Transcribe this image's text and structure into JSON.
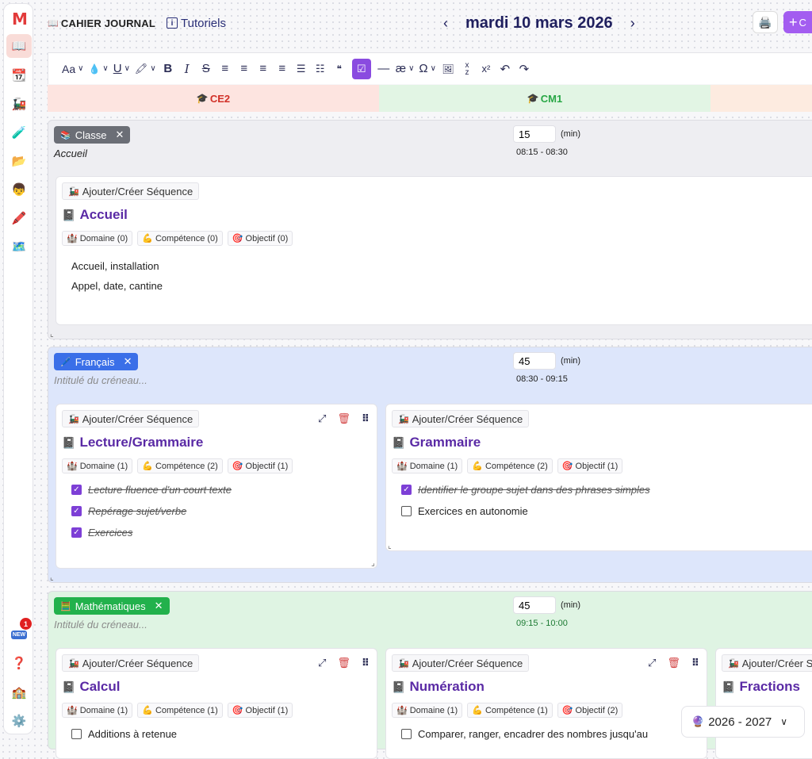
{
  "sidebar": {
    "logo": "M",
    "items": [
      {
        "name": "sidebar-item-journal",
        "icon": "📖",
        "active": true
      },
      {
        "name": "sidebar-item-calendar",
        "icon": "📆"
      },
      {
        "name": "sidebar-item-sequences",
        "icon": "🚂"
      },
      {
        "name": "sidebar-item-programs",
        "icon": "🧪"
      },
      {
        "name": "sidebar-item-files",
        "icon": "📂"
      },
      {
        "name": "sidebar-item-students",
        "icon": "👦"
      },
      {
        "name": "sidebar-item-evaluations",
        "icon": "🖍️"
      },
      {
        "name": "sidebar-item-gallery",
        "icon": "🗺️"
      }
    ],
    "news_label": "NEW",
    "news_count": "1",
    "help_icon": "❓",
    "school_icon": "🏫",
    "settings_icon": "⚙️"
  },
  "header": {
    "journal_icon": "📖",
    "journal_label": "CAHIER JOURNAL",
    "tutorials_label": "Tutoriels",
    "prev_arrow": "‹",
    "date": "mardi 10 mars 2026",
    "next_arrow": "›",
    "print_icon": "🖨️",
    "add_label": "C"
  },
  "toolbar": {
    "font_size": "Aa",
    "color": "💧",
    "underline": "U",
    "highlight": "🖍",
    "bold": "B",
    "italic": "I",
    "strike": "S",
    "align_left": "≡",
    "align_center": "≡",
    "align_right": "≡",
    "align_justify": "≡",
    "bullet_list": "☰",
    "ordered_list": "☷",
    "quote": "❝",
    "checklist": "☑",
    "hr": "—",
    "ligature": "æ",
    "omega": "Ω",
    "image": "🖼",
    "subscript": "x̤",
    "superscript": "x²",
    "undo": "↶",
    "redo": "↷"
  },
  "classes": [
    {
      "label": "CE2",
      "icon": "🎓"
    },
    {
      "label": "CM1",
      "icon": "🎓"
    }
  ],
  "slots": {
    "classe": {
      "tag": "Classe",
      "tag_icon": "📚",
      "title": "Accueil",
      "duration": "15",
      "min": "(min)",
      "time": "08:15 - 08:30",
      "card": {
        "seq_btn": "Ajouter/Créer Séquence",
        "seq_icon": "🚂",
        "title": "Accueil",
        "book_icon": "📓",
        "domain": "Domaine (0)",
        "competence": "Compétence (0)",
        "objectif": "Objectif (0)",
        "lines": [
          "Accueil, installation",
          "Appel, date, cantine"
        ]
      }
    },
    "francais": {
      "tag": "Français",
      "tag_icon": "🖊️",
      "title_placeholder": "Intitulé du créneau...",
      "duration": "45",
      "min": "(min)",
      "time": "08:30 - 09:15",
      "cards": [
        {
          "seq_btn": "Ajouter/Créer Séquence",
          "title": "Lecture/Grammaire",
          "domain": "Domaine (1)",
          "competence": "Compétence (2)",
          "objectif": "Objectif (1)",
          "items": [
            "Lecture fluence d'un court texte",
            "Repérage sujet/verbe",
            "Exercices"
          ]
        },
        {
          "seq_btn": "Ajouter/Créer Séquence",
          "title": "Grammaire",
          "domain": "Domaine (1)",
          "competence": "Compétence (2)",
          "objectif": "Objectif (1)",
          "items": [
            "Identifier le groupe sujet dans des phrases simples",
            "Exercices en autonomie"
          ]
        }
      ]
    },
    "maths": {
      "tag": "Mathématiques",
      "tag_icon": "🧮",
      "title_placeholder": "Intitulé du créneau...",
      "duration": "45",
      "min": "(min)",
      "time": "09:15 - 10:00",
      "cards": [
        {
          "seq_btn": "Ajouter/Créer Séquence",
          "title": "Calcul",
          "domain": "Domaine (1)",
          "competence": "Compétence (1)",
          "objectif": "Objectif (1)",
          "items": [
            "Additions à retenue"
          ]
        },
        {
          "seq_btn": "Ajouter/Créer Séquence",
          "title": "Numération",
          "domain": "Domaine (1)",
          "competence": "Compétence (1)",
          "objectif": "Objectif (2)",
          "items": [
            "Comparer, ranger, encadrer des nombres jusqu'au"
          ]
        },
        {
          "seq_btn": "Ajouter/Créer S",
          "title": "Fractions"
        }
      ]
    }
  },
  "chip_icons": {
    "domain": "🏰",
    "competence": "💪",
    "objectif": "🎯"
  },
  "card_icons": {
    "expand": "⤢",
    "trash": "🗑",
    "drag": "⠿",
    "close": "✕",
    "corner": "⌞"
  },
  "year_selector": {
    "icon": "🔮",
    "label": "2026 - 2027",
    "chevron": "⌄"
  },
  "colors": {
    "accent": "#8a4be0",
    "classe_bg": "#eeeef2",
    "francais_bg": "#dde6fb",
    "maths_bg": "#dff4e3",
    "classe_tag": "#6b6e76",
    "francais_tag": "#3a6fe8",
    "maths_tag": "#22b14c"
  }
}
